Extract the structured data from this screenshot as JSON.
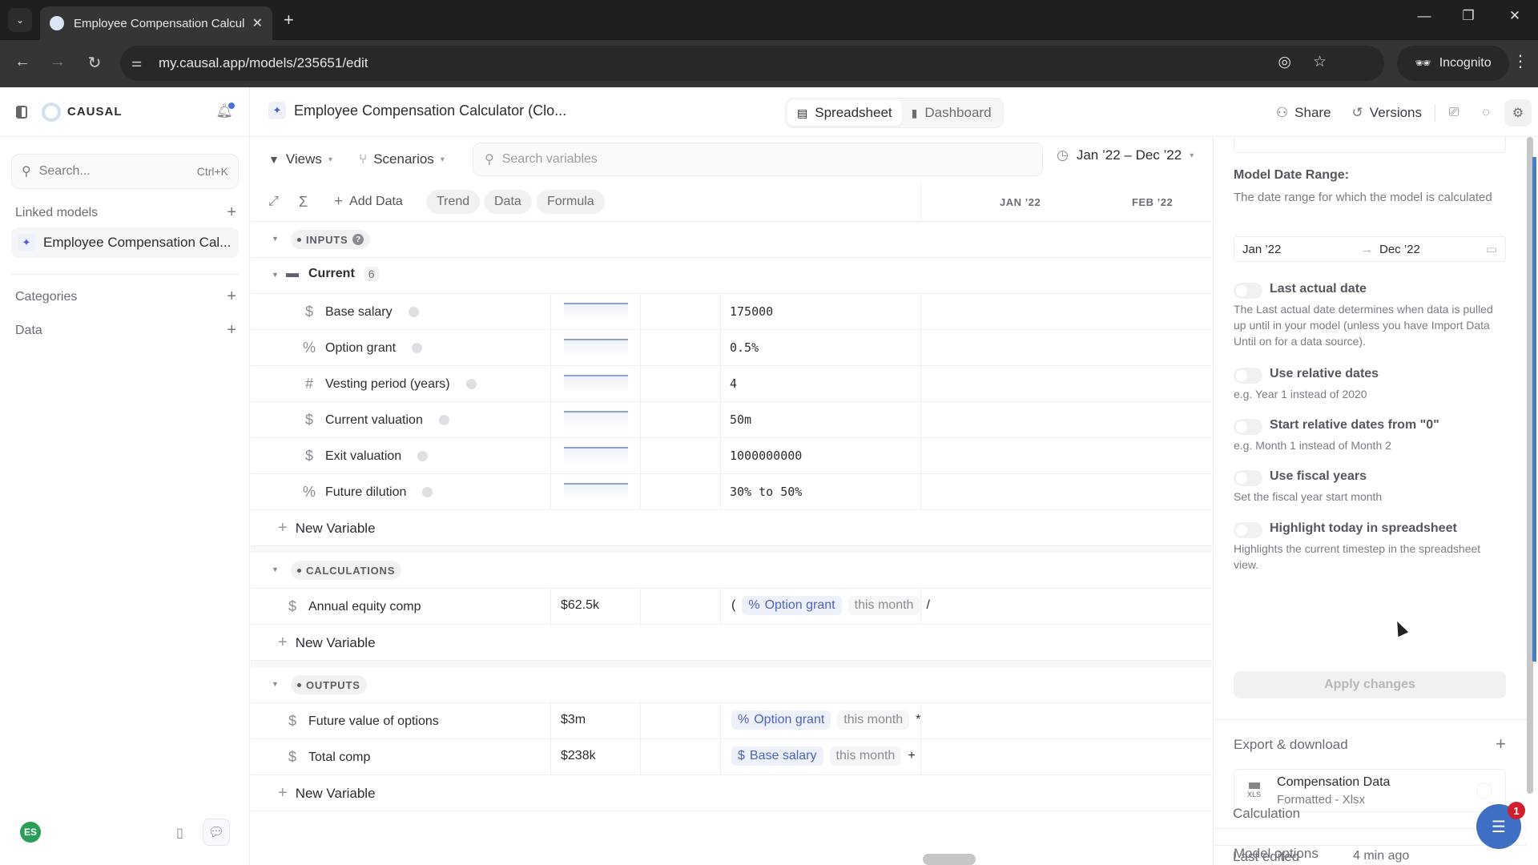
{
  "browser": {
    "tab_title": "Employee Compensation Calcul",
    "new_tab": "+",
    "close_tab": "✕",
    "url": "my.causal.app/models/235651/edit",
    "profile": "Incognito",
    "window_controls": {
      "minimize": "—",
      "restore": "❐",
      "close": "✕"
    },
    "nav": {
      "back": "←",
      "forward": "→",
      "reload": "↻"
    }
  },
  "sidebar": {
    "brand": "CAUSAL",
    "search": {
      "placeholder": "Search...",
      "shortcut": "Ctrl+K"
    },
    "linked_models_label": "Linked models",
    "linked_models": [
      {
        "name": "Employee Compensation Cal..."
      }
    ],
    "categories_label": "Categories",
    "data_label": "Data",
    "avatar_initials": "ES",
    "accent_color": "#4b5fc4",
    "notification_dot_color": "#4a6fd4"
  },
  "header": {
    "model_title": "Employee Compensation Calculator (Clo...",
    "views": [
      {
        "label": "Spreadsheet",
        "active": true
      },
      {
        "label": "Dashboard",
        "active": false
      }
    ],
    "share_label": "Share",
    "versions_label": "Versions"
  },
  "toolbar": {
    "views_label": "Views",
    "scenarios_label": "Scenarios",
    "search_placeholder": "Search variables",
    "date_range": "Jan ’22 – Dec ’22",
    "add_data_label": "Add Data",
    "mode_pills": [
      "Trend",
      "Data",
      "Formula"
    ],
    "columns": [
      "JAN ’22",
      "FEB ’22"
    ]
  },
  "grid": {
    "inputs": {
      "label": "INPUTS",
      "group": {
        "name": "Current",
        "count": "6"
      },
      "variables": [
        {
          "icon": "$",
          "name": "Base salary",
          "value": "175000"
        },
        {
          "icon": "%",
          "name": "Option grant",
          "value": "0.5%"
        },
        {
          "icon": "#",
          "name": "Vesting period (years)",
          "value": "4"
        },
        {
          "icon": "$",
          "name": "Current valuation",
          "value": "50m"
        },
        {
          "icon": "$",
          "name": "Exit valuation",
          "value": "1000000000"
        },
        {
          "icon": "%",
          "name": "Future dilution",
          "value": "30% to 50%"
        }
      ]
    },
    "new_variable_label": "New Variable",
    "calculations": {
      "label": "CALCULATIONS",
      "variables": [
        {
          "icon": "$",
          "name": "Annual equity comp",
          "value": "$62.5k",
          "formula": {
            "prefix": "(",
            "ref_icon": "%",
            "ref": "Option grant",
            "time": "this month",
            "op": "/"
          }
        }
      ]
    },
    "outputs": {
      "label": "OUTPUTS",
      "variables": [
        {
          "icon": "$",
          "name": "Future value of options",
          "value": "$3m",
          "formula": {
            "prefix": "",
            "ref_icon": "%",
            "ref": "Option grant",
            "time": "this month",
            "op": "*"
          }
        },
        {
          "icon": "$",
          "name": "Total comp",
          "value": "$238k",
          "formula": {
            "prefix": "",
            "ref_icon": "$",
            "ref": "Base salary",
            "time": "this month",
            "op": "+",
            "trail": "$"
          }
        }
      ]
    }
  },
  "settings_panel": {
    "model_date_range": {
      "heading": "Model Date Range:",
      "description": "The date range for which the model is calculated",
      "start": "Jan ’22",
      "end": "Dec ’22"
    },
    "options": [
      {
        "title": "Last actual date",
        "description": "The Last actual date determines when data is pulled up until in your model (unless you have Import Data Until on for a data source).",
        "enabled": false
      },
      {
        "title": "Use relative dates",
        "description": "e.g. Year 1 instead of 2020",
        "enabled": false
      },
      {
        "title": "Start relative dates from \"0\"",
        "description": "e.g. Month 1 instead of Month 2",
        "enabled": false
      },
      {
        "title": "Use fiscal years",
        "description": "Set the fiscal year start month",
        "enabled": false
      },
      {
        "title": "Highlight today in spreadsheet",
        "description": "Highlights the current timestep in the spreadsheet view.",
        "enabled": false
      }
    ],
    "apply_label": "Apply changes",
    "export": {
      "heading": "Export & download",
      "items": [
        {
          "name": "Compensation Data",
          "subtitle": "Formatted - Xlsx",
          "file_type": "XLS"
        }
      ]
    },
    "model_options_label": "Model options",
    "calculation_label": "Calculation",
    "last_edited_label": "Last edited",
    "last_edited_value": "4 min ago"
  },
  "chat_widget": {
    "badge_count": "1"
  }
}
